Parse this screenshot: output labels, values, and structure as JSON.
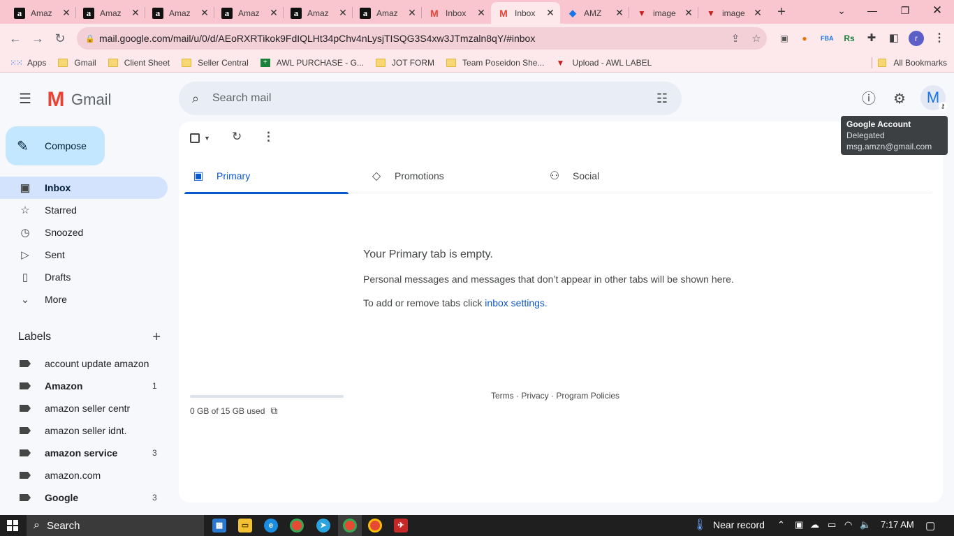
{
  "browser": {
    "tabs": [
      {
        "title": "Amaz",
        "icon": "amazon"
      },
      {
        "title": "Amaz",
        "icon": "amazon"
      },
      {
        "title": "Amaz",
        "icon": "amazon"
      },
      {
        "title": "Amaz",
        "icon": "amazon"
      },
      {
        "title": "Amaz",
        "icon": "amazon"
      },
      {
        "title": "Amaz",
        "icon": "amazon"
      },
      {
        "title": "Inbox",
        "icon": "gmail"
      },
      {
        "title": "Inbox",
        "icon": "gmail",
        "active": true
      },
      {
        "title": "AMZ",
        "icon": "amz"
      },
      {
        "title": "image",
        "icon": "awl"
      },
      {
        "title": "image",
        "icon": "awl"
      }
    ],
    "url": "mail.google.com/mail/u/0/d/AEoRXRTikok9FdIQLHt34pChv4nLysjTISQG3S4xw3JTmzaln8qY/#inbox",
    "profile_initial": "r",
    "bookmarks": [
      {
        "label": "Apps",
        "icon": "apps-grid"
      },
      {
        "label": "Gmail",
        "icon": "folder"
      },
      {
        "label": "Client Sheet",
        "icon": "folder"
      },
      {
        "label": "Seller Central",
        "icon": "folder"
      },
      {
        "label": "AWL PURCHASE - G...",
        "icon": "sheets"
      },
      {
        "label": "JOT FORM",
        "icon": "folder"
      },
      {
        "label": "Team Poseidon She...",
        "icon": "folder"
      },
      {
        "label": "Upload - AWL LABEL",
        "icon": "awl"
      }
    ],
    "all_bookmarks": "All Bookmarks"
  },
  "gmail": {
    "logo_text": "Gmail",
    "search_placeholder": "Search mail",
    "avatar_initial": "M",
    "tooltip": {
      "title": "Google Account",
      "status": "Delegated",
      "email": "msg.amzn@gmail.com"
    },
    "compose_label": "Compose",
    "nav": [
      {
        "label": "Inbox",
        "icon": "inbox-icon",
        "active": true
      },
      {
        "label": "Starred",
        "icon": "star-icon"
      },
      {
        "label": "Snoozed",
        "icon": "clock-icon"
      },
      {
        "label": "Sent",
        "icon": "send-icon"
      },
      {
        "label": "Drafts",
        "icon": "draft-icon"
      },
      {
        "label": "More",
        "icon": "chevron-down-icon"
      }
    ],
    "labels_title": "Labels",
    "labels": [
      {
        "name": "account update amazon",
        "count": "",
        "bold": false
      },
      {
        "name": "Amazon",
        "count": "1",
        "bold": true
      },
      {
        "name": "amazon seller centr",
        "count": "",
        "bold": false
      },
      {
        "name": "amazon seller idnt.",
        "count": "",
        "bold": false
      },
      {
        "name": "amazon service",
        "count": "3",
        "bold": true
      },
      {
        "name": "amazon.com",
        "count": "",
        "bold": false
      },
      {
        "name": "Google",
        "count": "3",
        "bold": true
      }
    ],
    "tabs": [
      {
        "label": "Primary",
        "active": true
      },
      {
        "label": "Promotions"
      },
      {
        "label": "Social"
      }
    ],
    "empty": {
      "heading": "Your Primary tab is empty.",
      "line1": "Personal messages and messages that don’t appear in other tabs will be shown here.",
      "line2_prefix": "To add or remove tabs click ",
      "line2_link": "inbox settings",
      "line2_suffix": "."
    },
    "storage": "0 GB of 15 GB used",
    "footer": {
      "terms": "Terms",
      "privacy": "Privacy",
      "policies": "Program Policies",
      "sep": " · "
    }
  },
  "taskbar": {
    "search_label": "Search",
    "weather": "Near record",
    "time": "7:17 AM"
  },
  "colors": {
    "tab_strip": "#f9c6d0",
    "compose": "#c2e7ff",
    "active_nav": "#d3e3fd",
    "accent": "#0b57d0"
  }
}
